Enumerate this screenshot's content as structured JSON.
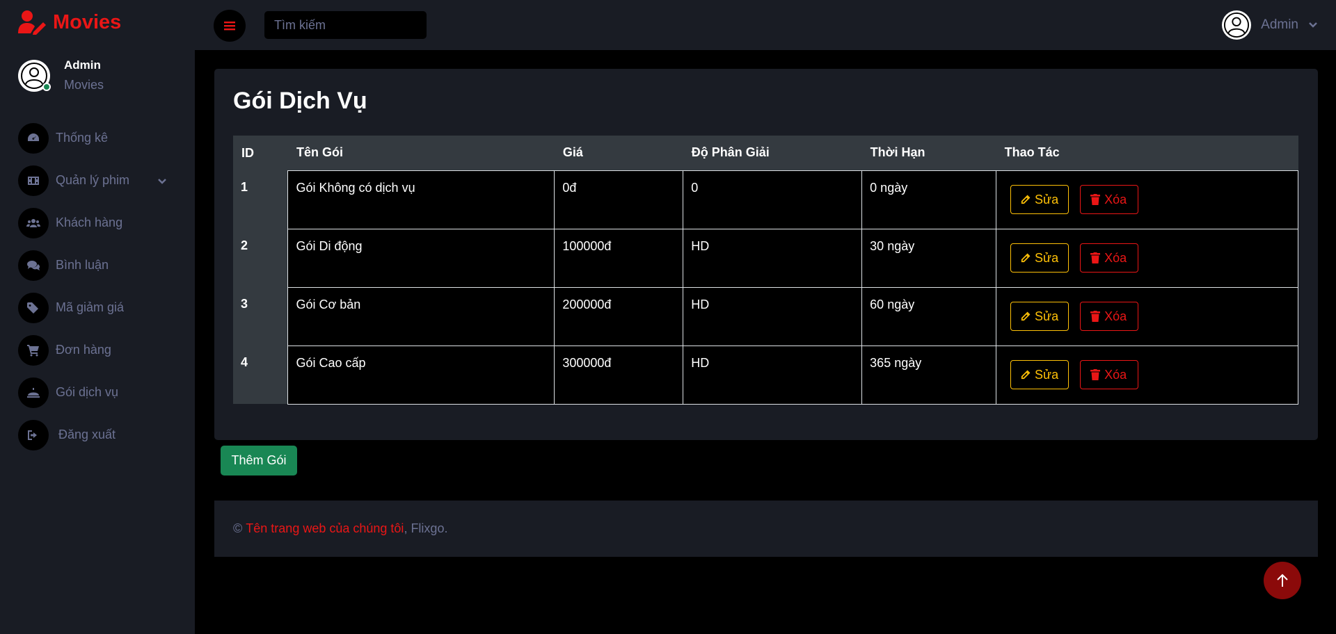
{
  "brand": {
    "name": "Movies",
    "icon": "user-edit-icon",
    "color": "#eb1616"
  },
  "profile": {
    "name": "Admin",
    "subtitle": "Movies",
    "status_color": "#198754"
  },
  "sidebar": {
    "items": [
      {
        "label": "Thống kê",
        "icon": "tachometer-icon"
      },
      {
        "label": "Quản lý phim",
        "icon": "film-icon",
        "has_dropdown": true
      },
      {
        "label": "Khách hàng",
        "icon": "users-icon"
      },
      {
        "label": "Bình luận",
        "icon": "comments-icon"
      },
      {
        "label": "Mã giảm giá",
        "icon": "tags-icon"
      },
      {
        "label": "Đơn hàng",
        "icon": "cart-icon"
      },
      {
        "label": "Gói dịch vụ",
        "icon": "bell-concierge-icon"
      },
      {
        "label": "Đăng xuất",
        "icon": "sign-out-icon"
      }
    ]
  },
  "topbar": {
    "search_placeholder": "Tìm kiếm",
    "user_name": "Admin"
  },
  "page": {
    "title": "Gói Dịch Vụ",
    "table": {
      "headers": [
        "ID",
        "Tên Gói",
        "Giá",
        "Độ Phân Giải",
        "Thời Hạn",
        "Thao Tác"
      ],
      "rows": [
        {
          "id": "1",
          "name": "Gói Không có dịch vụ",
          "price": "0đ",
          "resolution": "0",
          "duration": "0 ngày"
        },
        {
          "id": "2",
          "name": "Gói Di động",
          "price": "100000đ",
          "resolution": "HD",
          "duration": "30 ngày"
        },
        {
          "id": "3",
          "name": "Gói Cơ bản",
          "price": "200000đ",
          "resolution": "HD",
          "duration": "60 ngày"
        },
        {
          "id": "4",
          "name": "Gói Cao cấp",
          "price": "300000đ",
          "resolution": "HD",
          "duration": "365 ngày"
        }
      ],
      "edit_label": "Sửa",
      "delete_label": "Xóa"
    },
    "add_button": "Thêm Gói"
  },
  "footer": {
    "copyright": "©",
    "site_name": "Tên trang web của chúng tôi",
    "suffix": ", Flixgo."
  },
  "colors": {
    "accent": "#eb1616",
    "sidebar_bg": "#191c24",
    "warning": "#ffc107",
    "success": "#198754"
  }
}
